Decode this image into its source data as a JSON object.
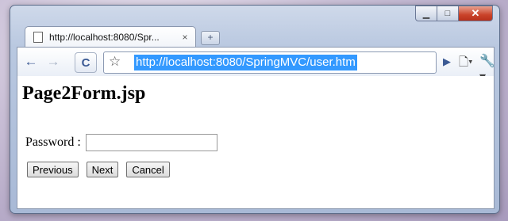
{
  "window": {
    "controls": {
      "minimize": "▁",
      "maximize": "□",
      "close": "✕"
    }
  },
  "tabs": [
    {
      "title": "http://localhost:8080/Spr...",
      "close": "×"
    }
  ],
  "new_tab_label": "+",
  "toolbar": {
    "back_icon": "←",
    "forward_icon": "→",
    "reload_icon": "C",
    "star_icon": "☆",
    "url": "http://localhost:8080/SpringMVC/user.htm",
    "go_icon": "▶",
    "page_menu_icon": "🗋▾",
    "wrench_icon": "🔧▾"
  },
  "page": {
    "heading": "Page2Form.jsp",
    "password_label": "Password :",
    "password_value": "",
    "buttons": {
      "previous": "Previous",
      "next": "Next",
      "cancel": "Cancel"
    }
  }
}
